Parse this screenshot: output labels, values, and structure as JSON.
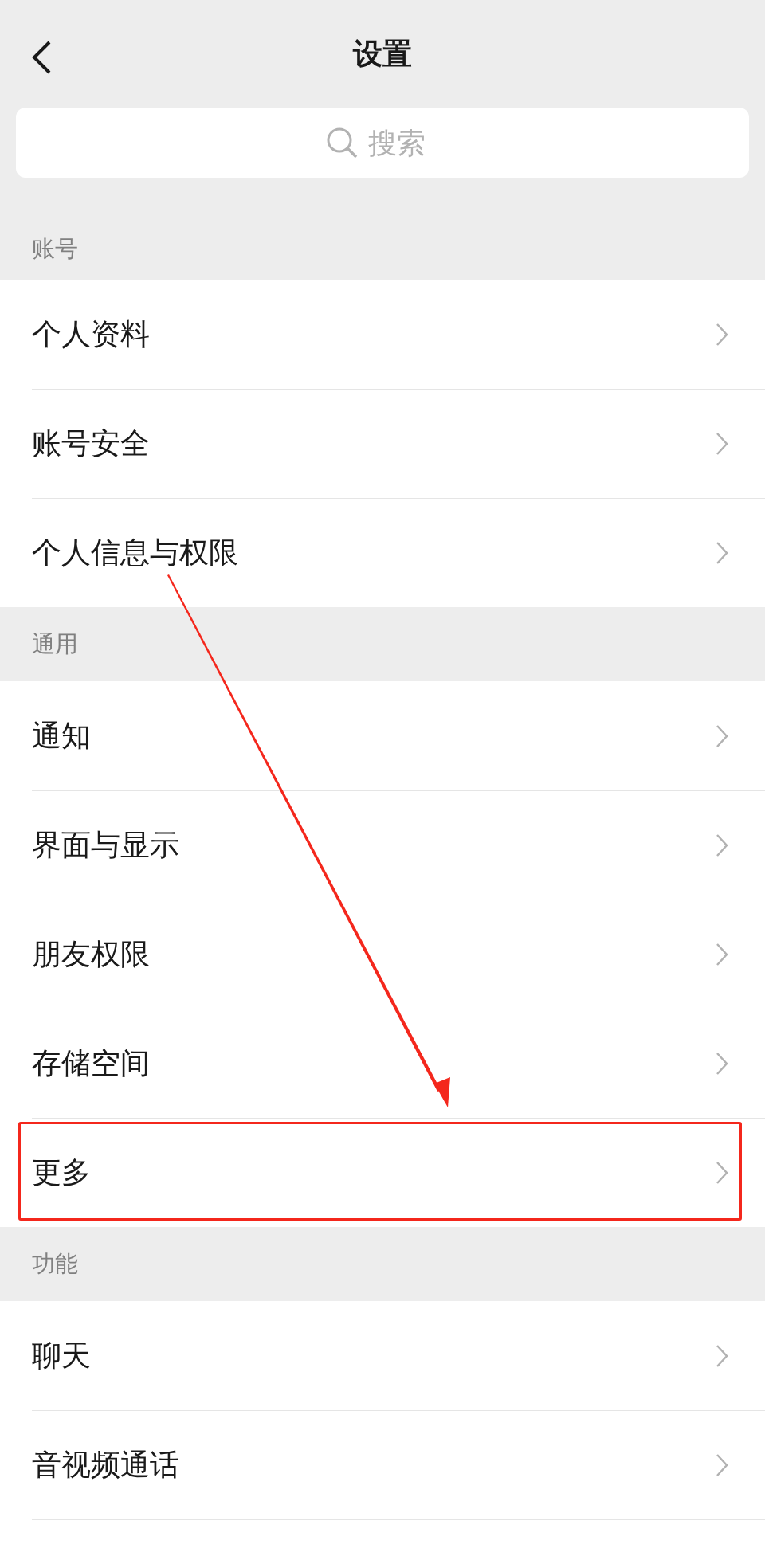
{
  "header": {
    "title": "设置"
  },
  "search": {
    "placeholder": "搜索"
  },
  "sections": [
    {
      "title": "账号",
      "items": [
        {
          "label": "个人资料",
          "highlighted": false
        },
        {
          "label": "账号安全",
          "highlighted": false
        },
        {
          "label": "个人信息与权限",
          "highlighted": false
        }
      ]
    },
    {
      "title": "通用",
      "items": [
        {
          "label": "通知",
          "highlighted": false
        },
        {
          "label": "界面与显示",
          "highlighted": false
        },
        {
          "label": "朋友权限",
          "highlighted": false
        },
        {
          "label": "存储空间",
          "highlighted": false
        },
        {
          "label": "更多",
          "highlighted": true
        }
      ]
    },
    {
      "title": "功能",
      "items": [
        {
          "label": "聊天",
          "highlighted": false
        },
        {
          "label": "音视频通话",
          "highlighted": false
        }
      ]
    }
  ],
  "annotation": {
    "kind": "arrow"
  }
}
